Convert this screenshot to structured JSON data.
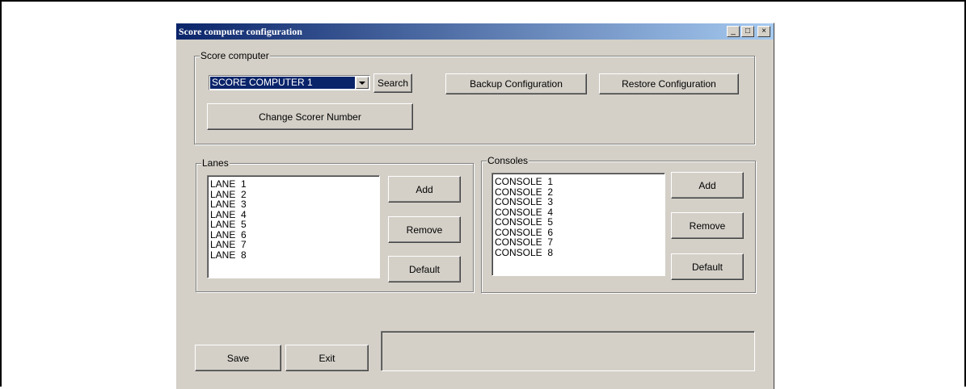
{
  "window": {
    "title": "Score computer configuration",
    "controls": [
      "_",
      "□",
      "×"
    ]
  },
  "score_computer": {
    "group_label": "Score computer",
    "selected": "SCORE COMPUTER 1",
    "search_label": "Search",
    "backup_label": "Backup Configuration",
    "restore_label": "Restore Configuration",
    "change_scorer_label": "Change Scorer Number"
  },
  "lanes": {
    "group_label": "Lanes",
    "items": [
      "LANE  1",
      "LANE  2",
      "LANE  3",
      "LANE  4",
      "LANE  5",
      "LANE  6",
      "LANE  7",
      "LANE  8"
    ],
    "add_label": "Add",
    "remove_label": "Remove",
    "default_label": "Default"
  },
  "consoles": {
    "group_label": "Consoles",
    "items": [
      "CONSOLE  1",
      "CONSOLE  2",
      "CONSOLE  3",
      "CONSOLE  4",
      "CONSOLE  5",
      "CONSOLE  6",
      "CONSOLE  7",
      "CONSOLE  8"
    ],
    "add_label": "Add",
    "remove_label": "Remove",
    "default_label": "Default"
  },
  "footer": {
    "save_label": "Save",
    "exit_label": "Exit",
    "status_text": ""
  }
}
